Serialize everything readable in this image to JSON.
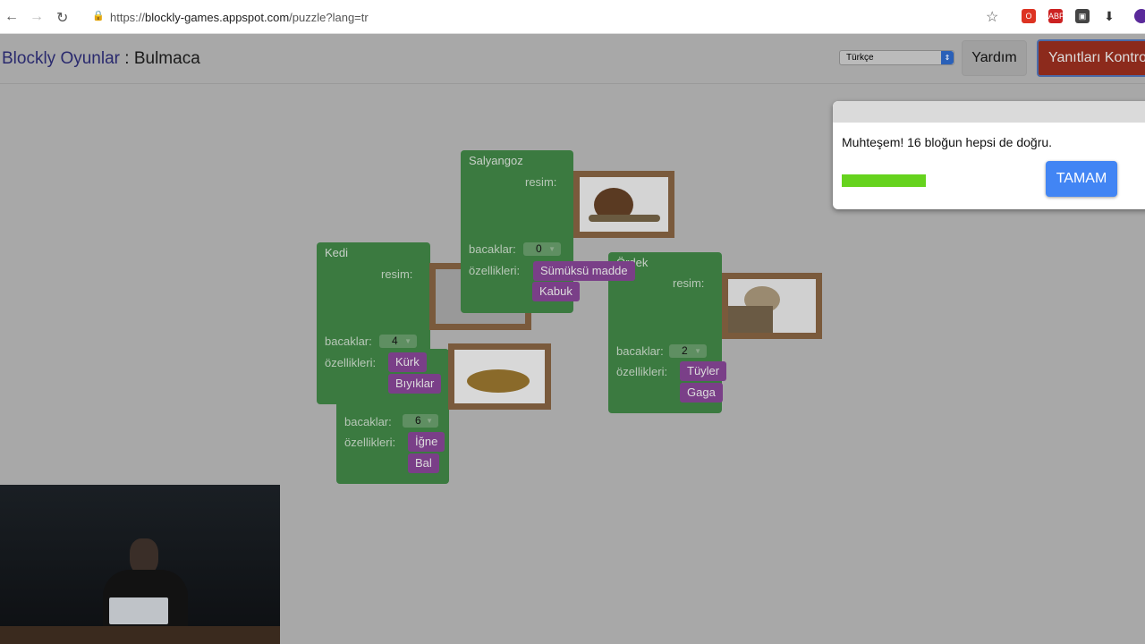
{
  "browser": {
    "url_scheme": "https://",
    "url_host": "blockly-games.appspot.com",
    "url_path": "/puzzle?lang=tr"
  },
  "header": {
    "app_title": "Blockly Oyunlar",
    "separator": " : ",
    "page_title": "Bulmaca",
    "language": "Türkçe",
    "help_label": "Yardım",
    "check_label": "Yanıtları Kontrol Et"
  },
  "blocks": {
    "kedi": {
      "name": "Kedi",
      "picture_label": "resim:",
      "legs_label": "bacaklar:",
      "legs": "4",
      "traits_label": "özellikleri:",
      "traits": [
        "Kürk",
        "Bıyıklar"
      ]
    },
    "bee": {
      "legs_label": "bacaklar:",
      "legs": "6",
      "traits_label": "özellikleri:",
      "traits": [
        "İğne",
        "Bal"
      ]
    },
    "salyangoz": {
      "name": "Salyangoz",
      "picture_label": "resim:",
      "legs_label": "bacaklar:",
      "legs": "0",
      "traits_label": "özellikleri:",
      "traits": [
        "Sümüksü madde",
        "Kabuk"
      ]
    },
    "ordek": {
      "name": "Ördek",
      "picture_label": "resim:",
      "legs_label": "bacaklar:",
      "legs": "2",
      "traits_label": "özellikleri:",
      "traits": [
        "Tüyler",
        "Gaga"
      ]
    }
  },
  "dialog": {
    "message": "Muhteşem! 16 bloğun hepsi de doğru.",
    "progress": 1.0,
    "ok_label": "TAMAM"
  },
  "colors": {
    "block": "#3b7a40",
    "trait": "#7a3f88",
    "progress": "#66d31e",
    "ok": "#4285f4",
    "check": "#8c2a1c"
  }
}
